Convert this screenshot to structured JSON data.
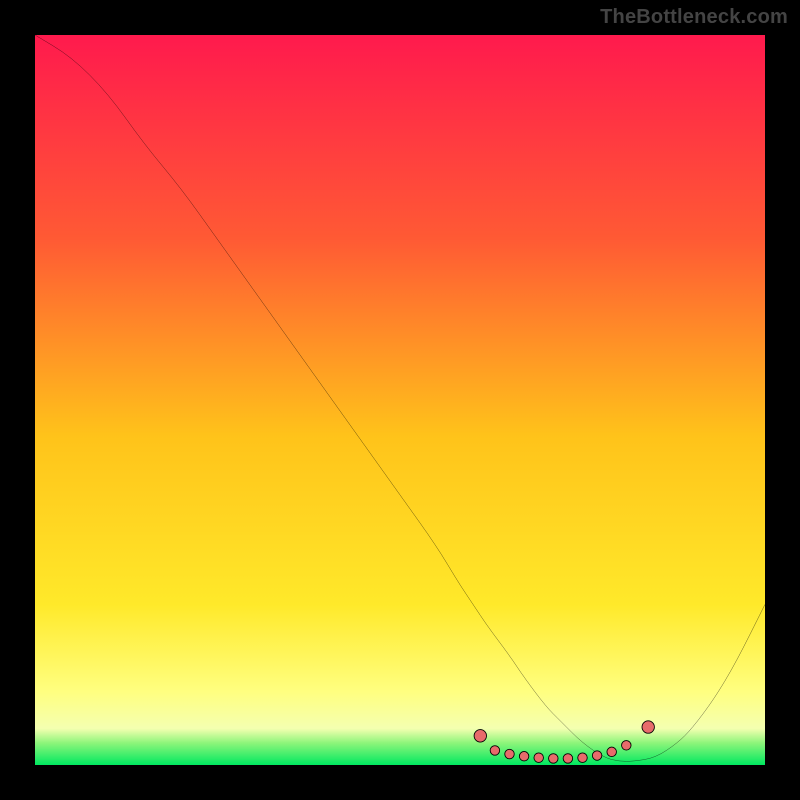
{
  "watermark": "TheBottleneck.com",
  "chart_data": {
    "type": "line",
    "title": "",
    "xlabel": "",
    "ylabel": "",
    "x": [
      0,
      5,
      10,
      15,
      20,
      25,
      30,
      35,
      40,
      45,
      50,
      55,
      58,
      60,
      62,
      65,
      67,
      70,
      72,
      75,
      78,
      80,
      82,
      85,
      88,
      90,
      93,
      96,
      100
    ],
    "values": [
      100,
      97,
      92,
      85,
      79,
      72,
      65,
      58,
      51,
      44,
      37,
      30,
      25,
      22,
      19,
      15,
      12,
      8,
      6,
      3,
      1,
      0.5,
      0.5,
      1,
      3,
      5,
      9,
      14,
      22
    ],
    "xlim": [
      0,
      100
    ],
    "ylim": [
      0,
      100
    ],
    "gradient_colors": {
      "top": "#ff1a4d",
      "mid_upper": "#ff6a2e",
      "mid": "#ffd21a",
      "lower_yellow": "#ffff66",
      "green_band": "#00e860"
    },
    "curve_stroke": "#000000",
    "dot_fill": "#e76b6b",
    "dot_stroke": "#000000",
    "dots": [
      {
        "x": 61,
        "y": 4
      },
      {
        "x": 63,
        "y": 2
      },
      {
        "x": 65,
        "y": 1.5
      },
      {
        "x": 67,
        "y": 1.2
      },
      {
        "x": 69,
        "y": 1.0
      },
      {
        "x": 71,
        "y": 0.9
      },
      {
        "x": 73,
        "y": 0.9
      },
      {
        "x": 75,
        "y": 1.0
      },
      {
        "x": 77,
        "y": 1.3
      },
      {
        "x": 79,
        "y": 1.8
      },
      {
        "x": 81,
        "y": 2.7
      },
      {
        "x": 84,
        "y": 5.2
      }
    ]
  }
}
